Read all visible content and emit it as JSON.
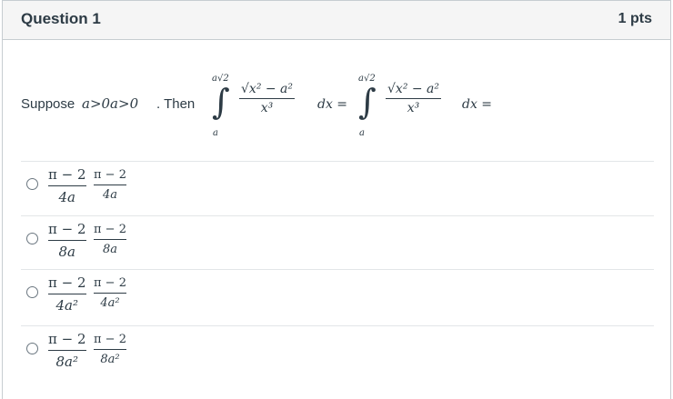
{
  "question": {
    "title": "Question 1",
    "points": "1 pts",
    "stem_prefix": "Suppose",
    "stem_condition": "a>0a>0",
    "stem_then": ". Then",
    "integral": {
      "lower": "a",
      "upper": "a√2",
      "numerator": "√x² − a²",
      "denominator": "x³",
      "differential": "dx =",
      "equals_repeat": "dx ="
    }
  },
  "options": [
    {
      "numerator": "π − 2",
      "denominator": "4a"
    },
    {
      "numerator": "π − 2",
      "denominator": "8a"
    },
    {
      "numerator": "π − 2",
      "denominator": "4a²"
    },
    {
      "numerator": "π − 2",
      "denominator": "8a²"
    }
  ]
}
